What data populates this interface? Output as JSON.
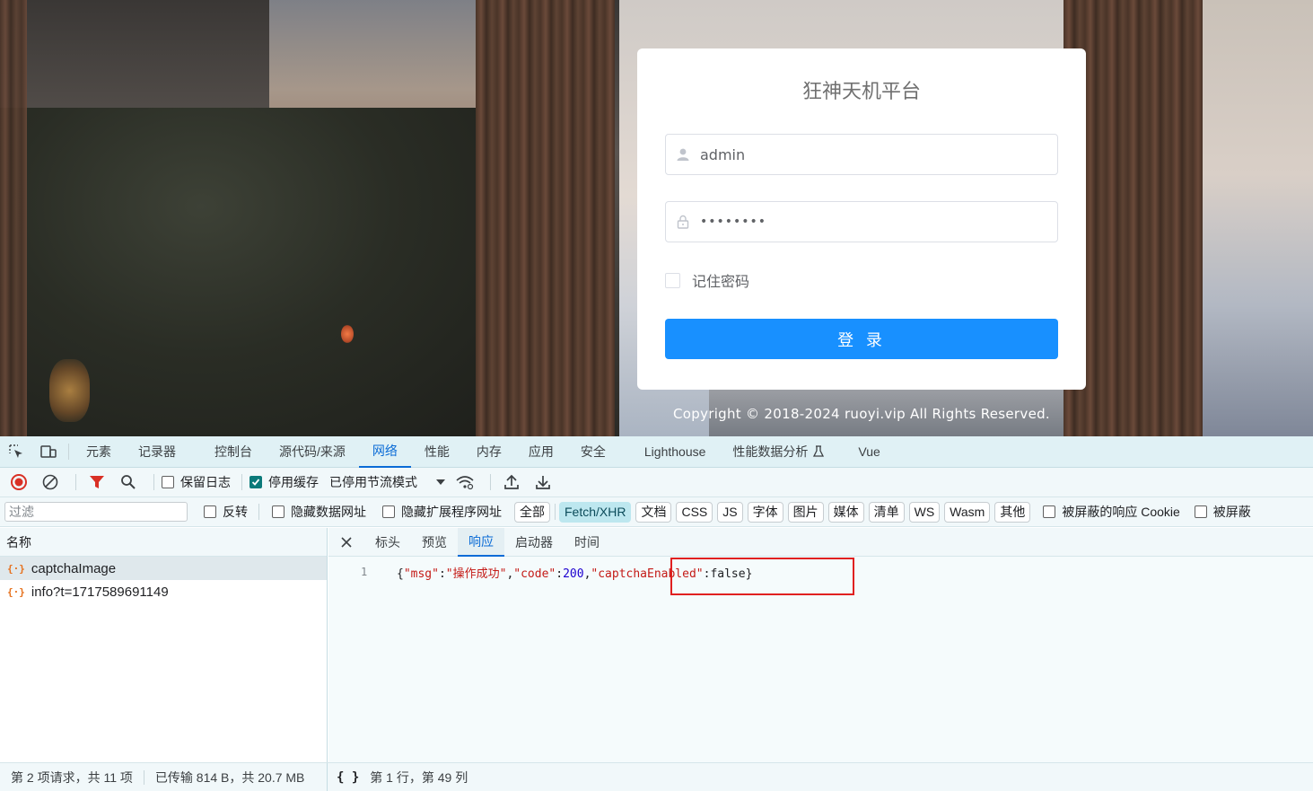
{
  "login": {
    "title": "狂神天机平台",
    "username_value": "admin",
    "password_value": "••••••••",
    "remember_label": "记住密码",
    "login_button": "登 录",
    "copyright": "Copyright © 2018-2024 ruoyi.vip All Rights Reserved."
  },
  "devtools": {
    "tabs": [
      "元素",
      "记录器",
      "控制台",
      "源代码/来源",
      "网络",
      "性能",
      "内存",
      "应用",
      "安全",
      "Lighthouse",
      "性能数据分析",
      "Vue"
    ],
    "active_tab": "网络",
    "toolbar": {
      "preserve_log": "保留日志",
      "disable_cache": "停用缓存",
      "throttle": "已停用节流模式"
    },
    "filter": {
      "placeholder": "过滤",
      "invert": "反转",
      "hide_data_urls": "隐藏数据网址",
      "hide_ext_urls": "隐藏扩展程序网址",
      "types": [
        "全部",
        "Fetch/XHR",
        "文档",
        "CSS",
        "JS",
        "字体",
        "图片",
        "媒体",
        "清单",
        "WS",
        "Wasm",
        "其他"
      ],
      "active_type": "Fetch/XHR",
      "blocked_cookie": "被屏蔽的响应 Cookie",
      "blocked_req": "被屏蔽"
    },
    "request_list": {
      "header": "名称",
      "rows": [
        "captchaImage",
        "info?t=1717589691149"
      ]
    },
    "detail": {
      "tabs": [
        "标头",
        "预览",
        "响应",
        "启动器",
        "时间"
      ],
      "active_tab": "响应",
      "line_number": "1",
      "response": {
        "open": "{",
        "k1": "\"msg\"",
        "c1": ":",
        "v1": "\"操作成功\"",
        "sep1": ",",
        "k2": "\"code\"",
        "c2": ":",
        "v2": "200",
        "sep2": ",",
        "k3": "\"captchaEnabled\"",
        "c3": ":",
        "v3": "false",
        "close": "}"
      }
    },
    "status": {
      "requests": "第 2 项请求，共 11 项",
      "transferred": "已传输 814 B，共 20.7 MB",
      "braces": "{ }",
      "position": "第 1 行，第 49 列"
    }
  },
  "colors": {
    "primary": "#1890ff",
    "devtools_bg": "#f1f8fa",
    "devtools_accent": "#0a6bd6",
    "highlight": "#e02020"
  }
}
